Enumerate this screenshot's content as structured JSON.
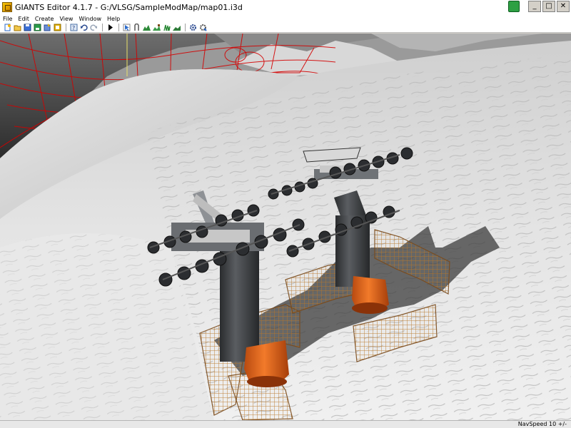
{
  "window": {
    "title": "GIANTS Editor 4.1.7 - G:/VLSG/SampleModMap/map01.i3d",
    "controls": {
      "minimize": "_",
      "maximize": "□",
      "close": "✕"
    },
    "accent_color": "#2ea043"
  },
  "menu": {
    "items": [
      {
        "label": "File"
      },
      {
        "label": "Edit"
      },
      {
        "label": "Create"
      },
      {
        "label": "View"
      },
      {
        "label": "Window"
      },
      {
        "label": "Help"
      }
    ]
  },
  "toolbar": {
    "icons": [
      "new-file-icon",
      "open-file-icon",
      "save-icon",
      "save-as-icon",
      "import-icon",
      "export-icon",
      "help-icon",
      "undo-icon",
      "redo-icon",
      "play-icon",
      "select-icon",
      "move-icon",
      "terrain-sculpt-icon",
      "terrain-paint-icon",
      "foliage-paint-icon",
      "place-object-icon",
      "settings-icon",
      "tools-icon"
    ]
  },
  "viewport": {
    "scene": "3d-viewport-ski-lift-towers",
    "colors": {
      "snow": "#e6e6e6",
      "pylon": "#3b3d40",
      "base_ring": "#e8661a",
      "wireframe": "#d40000",
      "fence": "#c8862e"
    }
  },
  "status": {
    "navspeed": "NavSpeed 10 +/-"
  }
}
